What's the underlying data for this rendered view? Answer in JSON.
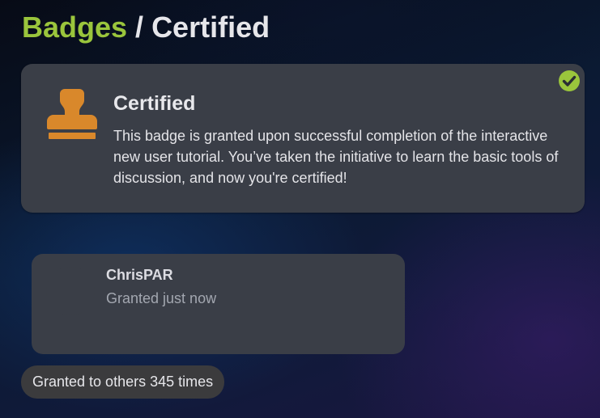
{
  "breadcrumb": {
    "parent": "Badges",
    "separator": " / ",
    "current": "Certified"
  },
  "badge": {
    "icon": "stamp-icon",
    "title": "Certified",
    "description": "This badge is granted upon successful completion of the interactive new user tutorial. You’ve taken the initiative to learn the basic tools of discussion, and now you're certified!",
    "granted_icon": "check-circle-icon"
  },
  "user_grant": {
    "username": "ChrisPAR",
    "granted_text": "Granted just now"
  },
  "others": {
    "label": "Granted to others 345 times"
  },
  "colors": {
    "accent_green": "#9ac53c",
    "badge_orange": "#d9882b",
    "card_bg": "#3a3e47"
  }
}
